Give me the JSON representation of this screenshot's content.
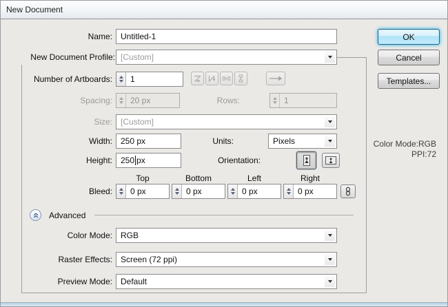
{
  "window": {
    "title": "New Document"
  },
  "action_buttons": {
    "ok": "OK",
    "cancel": "Cancel",
    "templates": "Templates..."
  },
  "form": {
    "name": {
      "label": "Name:",
      "value": "Untitled-1"
    },
    "profile": {
      "label": "New Document Profile:",
      "value": "[Custom]"
    },
    "artboards": {
      "label": "Number of Artboards:",
      "value": "1"
    },
    "spacing": {
      "label": "Spacing:",
      "value": "20 px"
    },
    "rows": {
      "label": "Rows:",
      "value": "1"
    },
    "size": {
      "label": "Size:",
      "value": "[Custom]"
    },
    "width": {
      "label": "Width:",
      "value": "250 px"
    },
    "units": {
      "label": "Units:",
      "value": "Pixels"
    },
    "height": {
      "label": "Height:",
      "value": "250",
      "unit": "px"
    },
    "orientation": {
      "label": "Orientation:"
    },
    "bleed": {
      "label": "Bleed:",
      "columns": [
        "Top",
        "Bottom",
        "Left",
        "Right"
      ],
      "values": [
        "0 px",
        "0 px",
        "0 px",
        "0 px"
      ]
    },
    "color_mode": {
      "label": "Color Mode:",
      "value": "RGB"
    },
    "raster_effects": {
      "label": "Raster Effects:",
      "value": "Screen (72 ppi)"
    },
    "preview_mode": {
      "label": "Preview Mode:",
      "value": "Default"
    }
  },
  "advanced_section": {
    "label": "Advanced"
  },
  "side_info": {
    "line1": "Color Mode:RGB",
    "line2": "PPI:72"
  },
  "icons": {
    "grid_by_row": "grid-by-row-icon",
    "grid_by_column": "grid-by-column-icon",
    "arrange_by_row": "arrange-by-row-icon",
    "arrange_by_column": "arrange-by-column-icon",
    "layout_direction": "right-arrow-icon",
    "portrait": "portrait-orientation-icon",
    "landscape": "landscape-orientation-icon",
    "bleed_link": "chain-link-icon",
    "advanced_toggle": "double-chevron-up-icon",
    "combo_arrow": "chevron-down-icon"
  },
  "colors": {
    "dialog_bg": "#ebe9e6",
    "default_button_glow": "#54c6ee",
    "default_button_border": "#2c628b",
    "disabled_text": "#9b9a97",
    "groupbox_border": "#9d9d9d"
  }
}
